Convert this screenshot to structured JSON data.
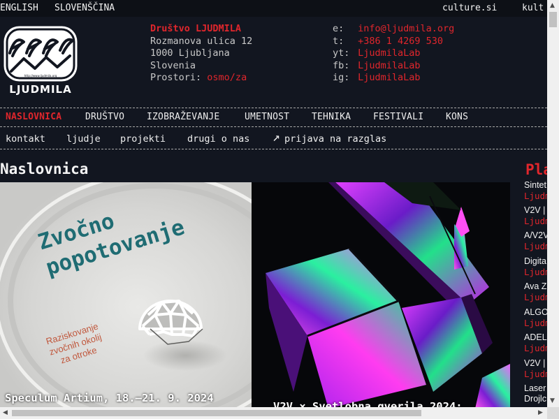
{
  "topbar": {
    "lang_en": "ENGLISH",
    "lang_sl": "SLOVENŠČINA",
    "culture": "culture.si",
    "kult": "kult"
  },
  "header": {
    "logo_text": "LJUDMILA",
    "logo_url_text": "http://www.ljudmila.org",
    "org_name": "Društvo LJUDMILA",
    "street": "Rozmanova ulica 12",
    "city": "1000 Ljubljana",
    "country": "Slovenia",
    "prostori_label": "Prostori:",
    "prostori_link": "osmo/za",
    "contacts": [
      {
        "key": "e:",
        "value": "info@ljudmila.org"
      },
      {
        "key": "t:",
        "value": "+386 1 4269 530"
      },
      {
        "key": "yt:",
        "value": "LjudmilaLab"
      },
      {
        "key": "fb:",
        "value": "LjudmilaLab"
      },
      {
        "key": "ig:",
        "value": "LjudmilaLab"
      }
    ]
  },
  "main_nav": [
    "NASLOVNICA",
    "DRUŠTVO",
    "IZOBRAŽEVANJE",
    "UMETNOST",
    "TEHNIKA",
    "FESTIVALI",
    "KONS"
  ],
  "sub_nav": {
    "items": [
      "kontakt",
      "ljudje",
      "projekti",
      "drugi o nas"
    ],
    "arrow": "↗",
    "newsletter": "prijava na razglas"
  },
  "page_title": "Naslovnica",
  "cards": [
    {
      "image_title_1": "Zvočno",
      "image_title_2": "popotovanje",
      "image_sub_1": "Raziskovanje",
      "image_sub_2": "zvočnih okolij",
      "image_sub_3": "za otroke",
      "caption": "Speculum Artium, 18.–21. 9. 2024"
    },
    {
      "caption": "V2V × Svetlobna gverila 2024:"
    }
  ],
  "sidebar": {
    "title": "Pla",
    "items": [
      {
        "title": "Sintet",
        "sub": "Ljudm"
      },
      {
        "title": "V2V |",
        "sub": "Ljudm"
      },
      {
        "title": "A/V2V",
        "sub": "Ljudm"
      },
      {
        "title": "Digita",
        "sub": "Ljudm"
      },
      {
        "title": "Ava Z",
        "sub": "Ljudm"
      },
      {
        "title": "ALGO",
        "sub": "Ljudm"
      },
      {
        "title": "ADEL",
        "sub": "Ljudm"
      },
      {
        "title": "V2V |",
        "sub": "Ljudm"
      },
      {
        "title": "Laser",
        "sub": "Drojlc"
      }
    ]
  },
  "colors": {
    "background": "#121620",
    "accent_red": "#e0262c",
    "teal": "#1f6c73"
  }
}
